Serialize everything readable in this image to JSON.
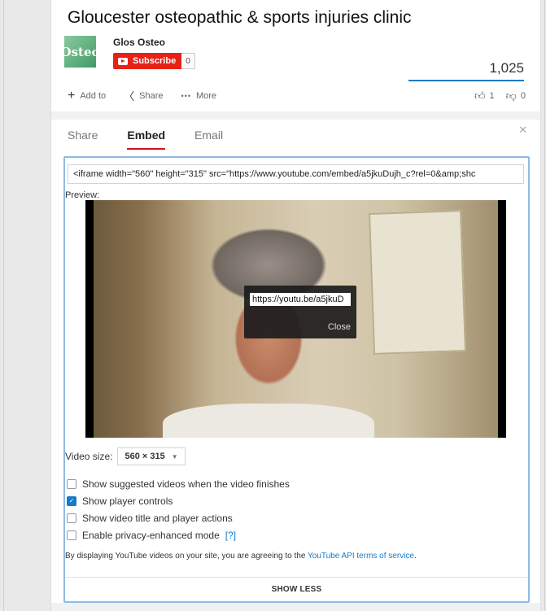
{
  "video": {
    "title": "Gloucester osteopathic & sports injuries clinic",
    "channel_name": "Glos Osteo",
    "channel_thumb_text": "Osteo",
    "subscribe_label": "Subscribe",
    "subscriber_count": "0",
    "view_count": "1,025"
  },
  "actions": {
    "add_to": "Add to",
    "share": "Share",
    "more": "More",
    "like_count": "1",
    "dislike_count": "0"
  },
  "tabs": [
    "Share",
    "Embed",
    "Email"
  ],
  "embed": {
    "code": "<iframe width=\"560\" height=\"315\" src=\"https://www.youtube.com/embed/a5jkuDujh_c?rel=0&amp;shc",
    "preview_label": "Preview:",
    "popup_url": "https://youtu.be/a5jkuD",
    "popup_close": "Close",
    "video_size_label": "Video size:",
    "video_size_value": "560 × 315",
    "options": [
      {
        "label": "Show suggested videos when the video finishes",
        "checked": false
      },
      {
        "label": "Show player controls",
        "checked": true
      },
      {
        "label": "Show video title and player actions",
        "checked": false
      },
      {
        "label": "Enable privacy-enhanced mode",
        "checked": false
      }
    ],
    "help_link": "[?]",
    "terms_prefix": "By displaying YouTube videos on your site, you are agreeing to the ",
    "terms_link": "YouTube API terms of service",
    "terms_suffix": ".",
    "show_less": "SHOW LESS"
  },
  "colors": {
    "subscribe_red": "#e62117",
    "link_blue": "#167ac6",
    "tab_active_underline": "#cc181e"
  }
}
